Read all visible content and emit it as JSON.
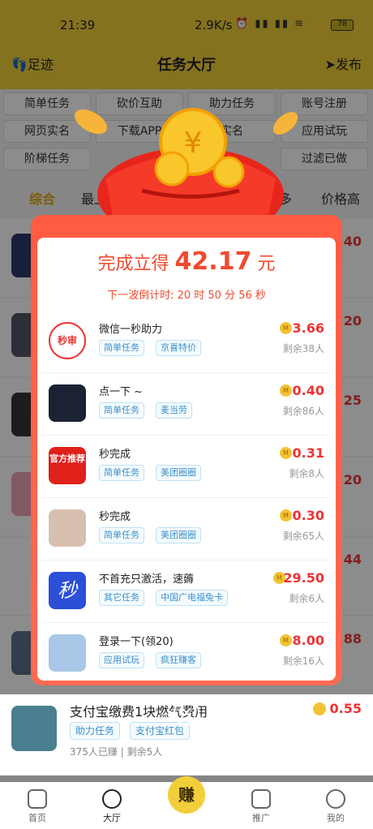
{
  "status": {
    "time": "21:39",
    "net": "2.9K/s",
    "battery": "78"
  },
  "nav": {
    "left": "足迹",
    "title": "任务大厅",
    "right": "发布"
  },
  "chips": {
    "r1": [
      "简单任务",
      "砍价互助",
      "助力任务",
      "账号注册"
    ],
    "r2": [
      "网页实名",
      "下载APP",
      "实名",
      "应用试玩"
    ],
    "r3": [
      "阶梯任务",
      "过滤已做"
    ]
  },
  "sort": {
    "tab0": "综合",
    "tab1": "最上架",
    "tab2": "成交多",
    "tab3": "价格高"
  },
  "base_prices": [
    ".40",
    ".20",
    ".25",
    ".20",
    ".44",
    ".88"
  ],
  "bottom_task": {
    "name": "支付宝缴费1块燃气费用",
    "tags": [
      "助力任务",
      "支付宝红包"
    ],
    "stats": "375人已赚  |  剩余5人",
    "price": "0.55"
  },
  "bottom_nav": [
    "首页",
    "大厅",
    "赚",
    "推广",
    "我的"
  ],
  "modal": {
    "headline_prefix": "完成立得",
    "amount": "42.17",
    "unit": "元",
    "countdown": "下一波倒计时: 20 时 50 分 56 秒",
    "offers": [
      {
        "name": "微信一秒助力",
        "tags": [
          "简单任务",
          "京喜特价"
        ],
        "price": "3.66",
        "remain": "剩余38人",
        "icon_color": "#ffffff",
        "icon_text": "秒审"
      },
      {
        "name": "点一下 ~",
        "tags": [
          "简单任务",
          "麦当劳"
        ],
        "price": "0.40",
        "remain": "剩余86人",
        "icon_color": "#1b2233",
        "icon_text": ""
      },
      {
        "name": "秒完成",
        "tags": [
          "简单任务",
          "美团圈圈"
        ],
        "price": "0.31",
        "remain": "剩余8人",
        "icon_color": "#e0201a",
        "icon_text": "官方推荐"
      },
      {
        "name": "秒完成",
        "tags": [
          "简单任务",
          "美团圈圈"
        ],
        "price": "0.30",
        "remain": "剩余65人",
        "icon_color": "#d8c0b0",
        "icon_text": ""
      },
      {
        "name": "不首充只激活，速薅",
        "tags": [
          "其它任务",
          "中国广电福兔卡"
        ],
        "price": "29.50",
        "remain": "剩余6人",
        "icon_color": "#2c4fd8",
        "icon_text": "秒"
      },
      {
        "name": "登录一下(领20)",
        "tags": [
          "应用试玩",
          "疯狂赚客"
        ],
        "price": "8.00",
        "remain": "剩余16人",
        "icon_color": "#a9c7e6",
        "icon_text": ""
      }
    ]
  },
  "coin_letter": "M",
  "close_glyph": "×"
}
